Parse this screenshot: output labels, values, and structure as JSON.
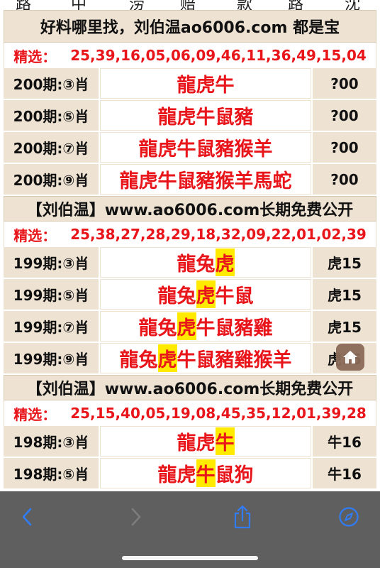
{
  "top_fragments": [
    "路",
    "中",
    "涝",
    "赔",
    "款",
    "路",
    "沈"
  ],
  "sections": [
    {
      "header": "好料哪里找，刘伯温ao6006.com 都是宝",
      "selected_label": "精选：",
      "selected_numbers": "25,39,16,05,06,09,46,11,36,49,15,04",
      "rows": [
        {
          "period": "200期:③肖",
          "pre": "",
          "hl": "",
          "post": "龍虎牛",
          "result": "?00"
        },
        {
          "period": "200期:⑤肖",
          "pre": "",
          "hl": "",
          "post": "龍虎牛鼠豬",
          "result": "?00"
        },
        {
          "period": "200期:⑦肖",
          "pre": "",
          "hl": "",
          "post": "龍虎牛鼠豬猴羊",
          "result": "?00"
        },
        {
          "period": "200期:⑨肖",
          "pre": "",
          "hl": "",
          "post": "龍虎牛鼠豬猴羊馬蛇",
          "result": "?00"
        }
      ]
    },
    {
      "header": "【刘伯温】www.ao6006.com长期免费公开",
      "selected_label": "精选：",
      "selected_numbers": "25,38,27,28,29,18,32,09,22,01,02,39",
      "rows": [
        {
          "period": "199期:③肖",
          "pre": "龍兔",
          "hl": "虎",
          "post": "",
          "result": "虎15"
        },
        {
          "period": "199期:⑤肖",
          "pre": "龍兔",
          "hl": "虎",
          "post": "牛鼠",
          "result": "虎15"
        },
        {
          "period": "199期:⑦肖",
          "pre": "龍兔",
          "hl": "虎",
          "post": "牛鼠豬雞",
          "result": "虎15"
        },
        {
          "period": "199期:⑨肖",
          "pre": "龍兔",
          "hl": "虎",
          "post": "牛鼠豬雞猴羊",
          "result": "虎15"
        }
      ]
    },
    {
      "header": "【刘伯温】www.ao6006.com长期免费公开",
      "selected_label": "精选：",
      "selected_numbers": "25,15,40,05,19,08,45,35,12,01,39,28",
      "rows": [
        {
          "period": "198期:③肖",
          "pre": "龍虎",
          "hl": "牛",
          "post": "",
          "result": "牛16"
        },
        {
          "period": "198期:⑤肖",
          "pre": "龍虎",
          "hl": "牛",
          "post": "鼠狗",
          "result": "牛16"
        }
      ]
    }
  ],
  "colors": {
    "accent_red": "#e8151b",
    "cell_beige": "#eee2d2",
    "highlight_yellow": "#ffea00",
    "toolbar_gray": "#5f5f5f",
    "ios_blue": "#2f7cf6"
  },
  "toolbar": {
    "back": "chevron-left-icon",
    "forward": "chevron-right-icon",
    "share": "share-icon",
    "compass": "compass-icon"
  }
}
